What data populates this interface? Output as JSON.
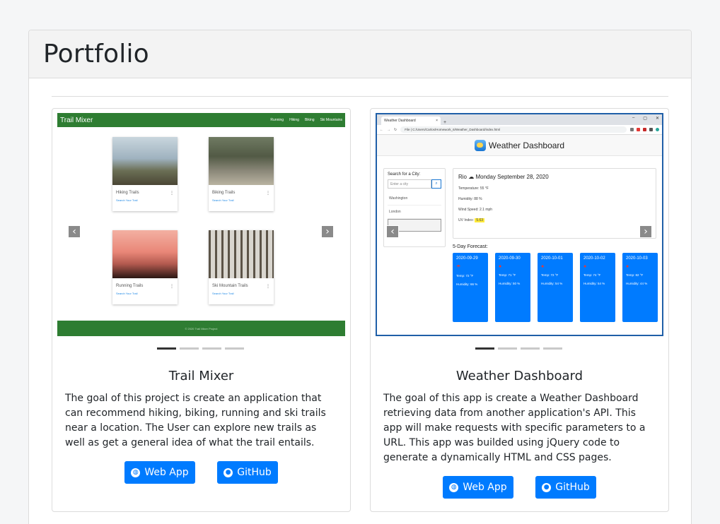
{
  "portfolio": {
    "title": "Portfolio"
  },
  "projects": [
    {
      "title": "Trail Mixer",
      "description": "The goal of this project is create an application that can recommend hiking, biking, running and ski trails near a location. The User can explore new trails as well as get a general idea of what the trail entails.",
      "webapp_label": "Web App",
      "github_label": "GitHub",
      "carousel_slides": 4,
      "carousel_active": 1,
      "screenshot": {
        "brand": "Trail Mixer",
        "nav_links": [
          "Running",
          "Hiking",
          "Biking",
          "Ski Mountains"
        ],
        "tiles": [
          {
            "title": "Hiking Trails",
            "link": "Search Your Trail"
          },
          {
            "title": "Biking Trails",
            "link": "Search Your Trail"
          },
          {
            "title": "Running Trails",
            "link": "Search Your Trail"
          },
          {
            "title": "Ski Mountain Trails",
            "link": "Search Your Trail"
          }
        ],
        "footer": "© 2020 Trail Mixer Project"
      }
    },
    {
      "title": "Weather Dashboard",
      "description": "The goal of this app is create a Weather Dashboard retrieving data from another application's API. This app will make requests with specific parameters to a URL. This app was builded using jQuery code to generate a dynamically HTML and CSS pages.",
      "webapp_label": "Web App",
      "github_label": "GitHub",
      "carousel_slides": 4,
      "carousel_active": 1,
      "screenshot": {
        "tab_title": "Weather Dashboard",
        "url_scheme": "File",
        "url": "C:/Users/Carlos/Homework_6/Weather_Dashboard/index.html",
        "app_title": "Weather Dashboard",
        "search_label": "Search for a City:",
        "search_placeholder": "Enter a city",
        "history": [
          "Washington",
          "London"
        ],
        "city_line": "Rio",
        "date_line": "Monday September 28, 2020",
        "temperature": "Temperature: 55 °F",
        "humidity": "Humidity: 88 %",
        "wind": "Wind Speed: 2.1 mph",
        "uv_label": "UV Index:",
        "uv_value": "5.63",
        "forecast_label": "5-Day Forecast:",
        "forecast": [
          {
            "date": "2020-09-29",
            "temp": "Temp: 72 °F",
            "humidity": "Humidity: 66 %"
          },
          {
            "date": "2020-09-30",
            "temp": "Temp: 71 °F",
            "humidity": "Humidity: 50 %"
          },
          {
            "date": "2020-10-01",
            "temp": "Temp: 72 °F",
            "humidity": "Humidity: 54 %"
          },
          {
            "date": "2020-10-02",
            "temp": "Temp: 74 °F",
            "humidity": "Humidity: 54 %"
          },
          {
            "date": "2020-10-03",
            "temp": "Temp: 82 °F",
            "humidity": "Humidity: 44 %"
          }
        ]
      }
    }
  ],
  "icons": {
    "prev": "chevron-left-icon",
    "next": "chevron-right-icon",
    "globe": "globe-icon",
    "github": "github-icon"
  }
}
